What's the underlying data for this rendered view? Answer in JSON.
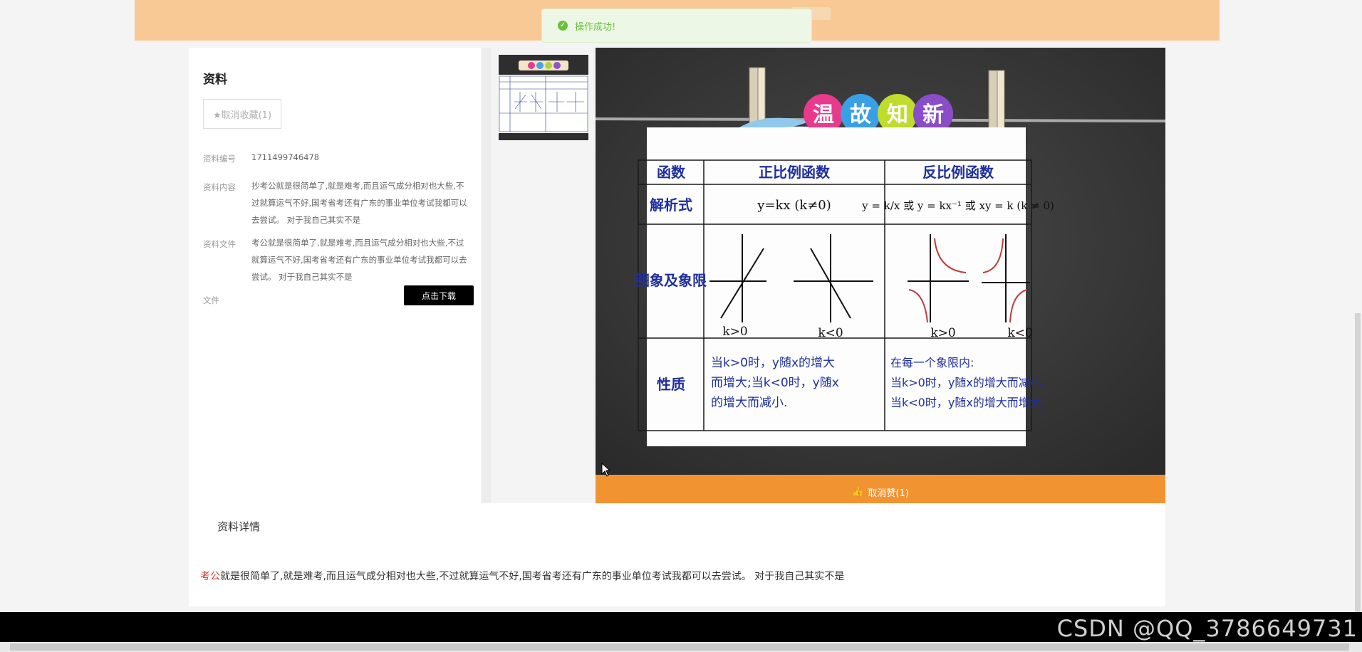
{
  "toast": {
    "message": "操作成功!"
  },
  "sidebar": {
    "title": "资料",
    "favorite_button": "★取消收藏(1)",
    "fields": [
      {
        "label": "资料编号",
        "value": "1711499746478"
      },
      {
        "label": "资料内容",
        "value": "抄考公就是很简单了,就是难考,而且运气成分相对也大些,不过就算运气不好,国考省考还有广东的事业单位考试我都可以去尝试。 对于我自己其实不是"
      },
      {
        "label": "资料文件",
        "value": "考公就是很简单了,就是难考,而且运气成分相对也大些,不过就算运气不好,国考省考还有广东的事业单位考试我都可以去尝试。 对于我自己其实不是"
      },
      {
        "label": "文件",
        "value": ""
      }
    ],
    "download_button": "点击下载"
  },
  "viewer": {
    "banner": [
      "温",
      "故",
      "知",
      "新"
    ],
    "table": {
      "headers": [
        "函数",
        "正比例函数",
        "反比例函数"
      ],
      "rows": [
        {
          "label": "解析式",
          "col1": "y=kx (k≠0)",
          "col2": "y = k/x 或 y = kx⁻¹ 或 xy = k (k ≠ 0)"
        },
        {
          "label": "图象及象限",
          "col1_a": "k>0",
          "col1_b": "k<0",
          "col2_a": "k>0",
          "col2_b": "k<0"
        },
        {
          "label": "性质",
          "col1": [
            "当k>0时，y随x的增大",
            "而增大;当k<0时，y随x",
            "的增大而减小."
          ],
          "col2": [
            "在每一个象限内:",
            "当k>0时，y随x的增大而减小;",
            "当k<0时，y随x的增大而增大."
          ]
        }
      ]
    },
    "like_button": "取消赞(1)"
  },
  "detail": {
    "title": "资料详情",
    "highlight": "考公",
    "body": "就是很简单了,就是难考,而且运气成分相对也大些,不过就算运气不好,国考省考还有广东的事业单位考试我都可以去尝试。 对于我自己其实不是"
  },
  "watermark": "CSDN @QQ_3786649731",
  "colors": {
    "top_band": "#f8c995",
    "like_bar": "#f29331",
    "toast_green": "#67c23a"
  }
}
